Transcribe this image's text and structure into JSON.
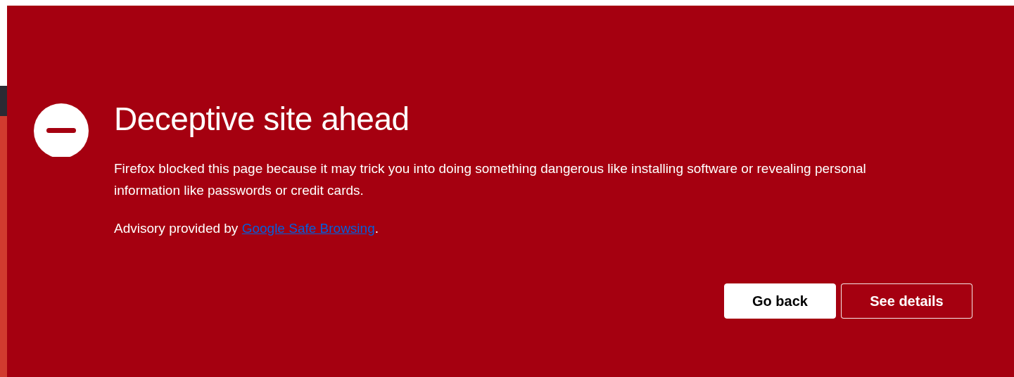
{
  "title": "Deceptive site ahead",
  "description": "Firefox blocked this page because it may trick you into doing something dangerous like installing software or revealing personal information like passwords or credit cards.",
  "advisory": {
    "prefix": "Advisory provided by ",
    "link": "Google Safe Browsing",
    "suffix": "."
  },
  "buttons": [
    {
      "label": "Go back",
      "kind": "primary"
    },
    {
      "label": "See details",
      "kind": "secondary"
    }
  ]
}
